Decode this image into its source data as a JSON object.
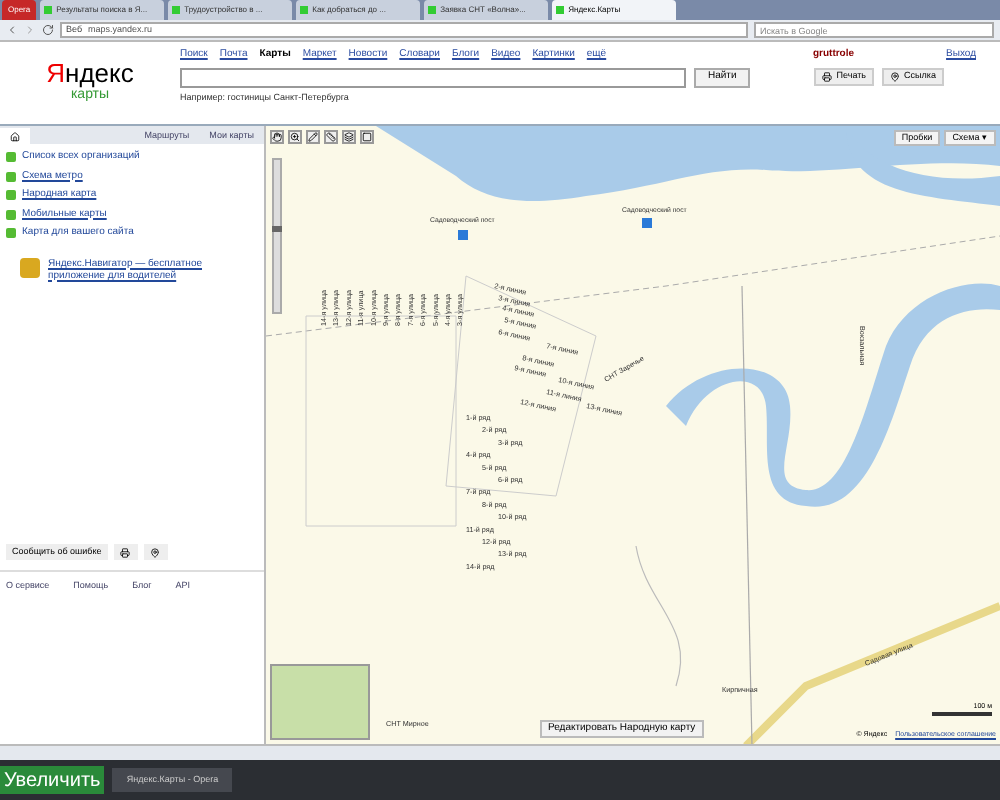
{
  "browser": {
    "menu": "Opera",
    "tabs": [
      {
        "title": "Результаты поиска в Я...",
        "selected": false
      },
      {
        "title": "Трудоустройство в ...",
        "selected": false
      },
      {
        "title": "Как добраться до ...",
        "selected": false
      },
      {
        "title": "Заявка СНТ «Волна»...",
        "selected": false
      },
      {
        "title": "Яндекс.Карты",
        "selected": true
      }
    ],
    "address_label": "Веб",
    "address": "maps.yandex.ru",
    "search_placeholder": "Искать в Google"
  },
  "header": {
    "logo": "Яндекс",
    "service": "карты",
    "nav": [
      {
        "label": "Поиск",
        "selected": false
      },
      {
        "label": "Почта",
        "selected": false
      },
      {
        "label": "Карты",
        "selected": true
      },
      {
        "label": "Маркет",
        "selected": false
      },
      {
        "label": "Новости",
        "selected": false
      },
      {
        "label": "Словари",
        "selected": false
      },
      {
        "label": "Блоги",
        "selected": false
      },
      {
        "label": "Видео",
        "selected": false
      },
      {
        "label": "Картинки",
        "selected": false
      },
      {
        "label": "ещё",
        "selected": false
      }
    ],
    "user": "gruttrole",
    "logout": "Выход",
    "search_button": "Найти",
    "hint": "Например: гостиницы Санкт-Петербурга",
    "print": "Печать",
    "link": "Ссылка"
  },
  "sidebar": {
    "tabs": [
      {
        "kind": "home",
        "selected": true
      },
      {
        "label": "Маршруты",
        "kind": "text",
        "selected": false
      },
      {
        "label": "Мои карты",
        "kind": "text",
        "selected": false
      }
    ],
    "items": [
      {
        "label": "Список всех организаций",
        "link": false
      },
      {
        "label": "Схема метро",
        "link": true
      },
      {
        "label": "Народная карта",
        "link": true
      },
      {
        "label": "Мобильные карты",
        "link": true
      },
      {
        "label": "Карта для вашего сайта",
        "link": false
      }
    ],
    "promo": "Яндекс.Навигатор — бесплатное приложение для водителей",
    "report": "Сообщить об ошибке",
    "footer": [
      "О сервисе",
      "Помощь",
      "Блог",
      "API"
    ]
  },
  "map": {
    "zoom": {
      "level": 0.55
    },
    "traffic": "Пробки",
    "layers": "Схема ▾",
    "stops": [
      "Садоводческий пост",
      "Садоводческий пост"
    ],
    "streets": [
      "14-я улица",
      "13-я улица",
      "12-я улица",
      "11-я улица",
      "10-я улица",
      "9-я улица",
      "8-я улица",
      "7-я улица",
      "6-я улица",
      "5-я улица",
      "4-я улица",
      "3-я улица"
    ],
    "lines": [
      "2-я линия",
      "3-я линия",
      "4-я линия",
      "5-я линия",
      "6-я линия",
      "7-я линия",
      "8-я линия",
      "9-я линия",
      "10-я линия",
      "11-я линия",
      "12-я линия",
      "13-я линия"
    ],
    "rows": [
      "1-й ряд",
      "2-й ряд",
      "3-й ряд",
      "4-й ряд",
      "5-й ряд",
      "6-й ряд",
      "7-й ряд",
      "8-й ряд",
      "10-й ряд",
      "11-й ряд",
      "12-й ряд",
      "13-й ряд",
      "14-й ряд"
    ],
    "other_labels": [
      "СНТ Заречье",
      "Вокзальная",
      "Кирпичная",
      "Садовая улица",
      "СНТ Мирное"
    ],
    "edit_button": "Редактировать Народную карту",
    "scale": "100 м",
    "copyright": "© Яндекс",
    "terms": "Пользовательское соглашение"
  },
  "taskbar": {
    "start": "Увеличить",
    "window": "Яндекс.Карты - Opera"
  }
}
